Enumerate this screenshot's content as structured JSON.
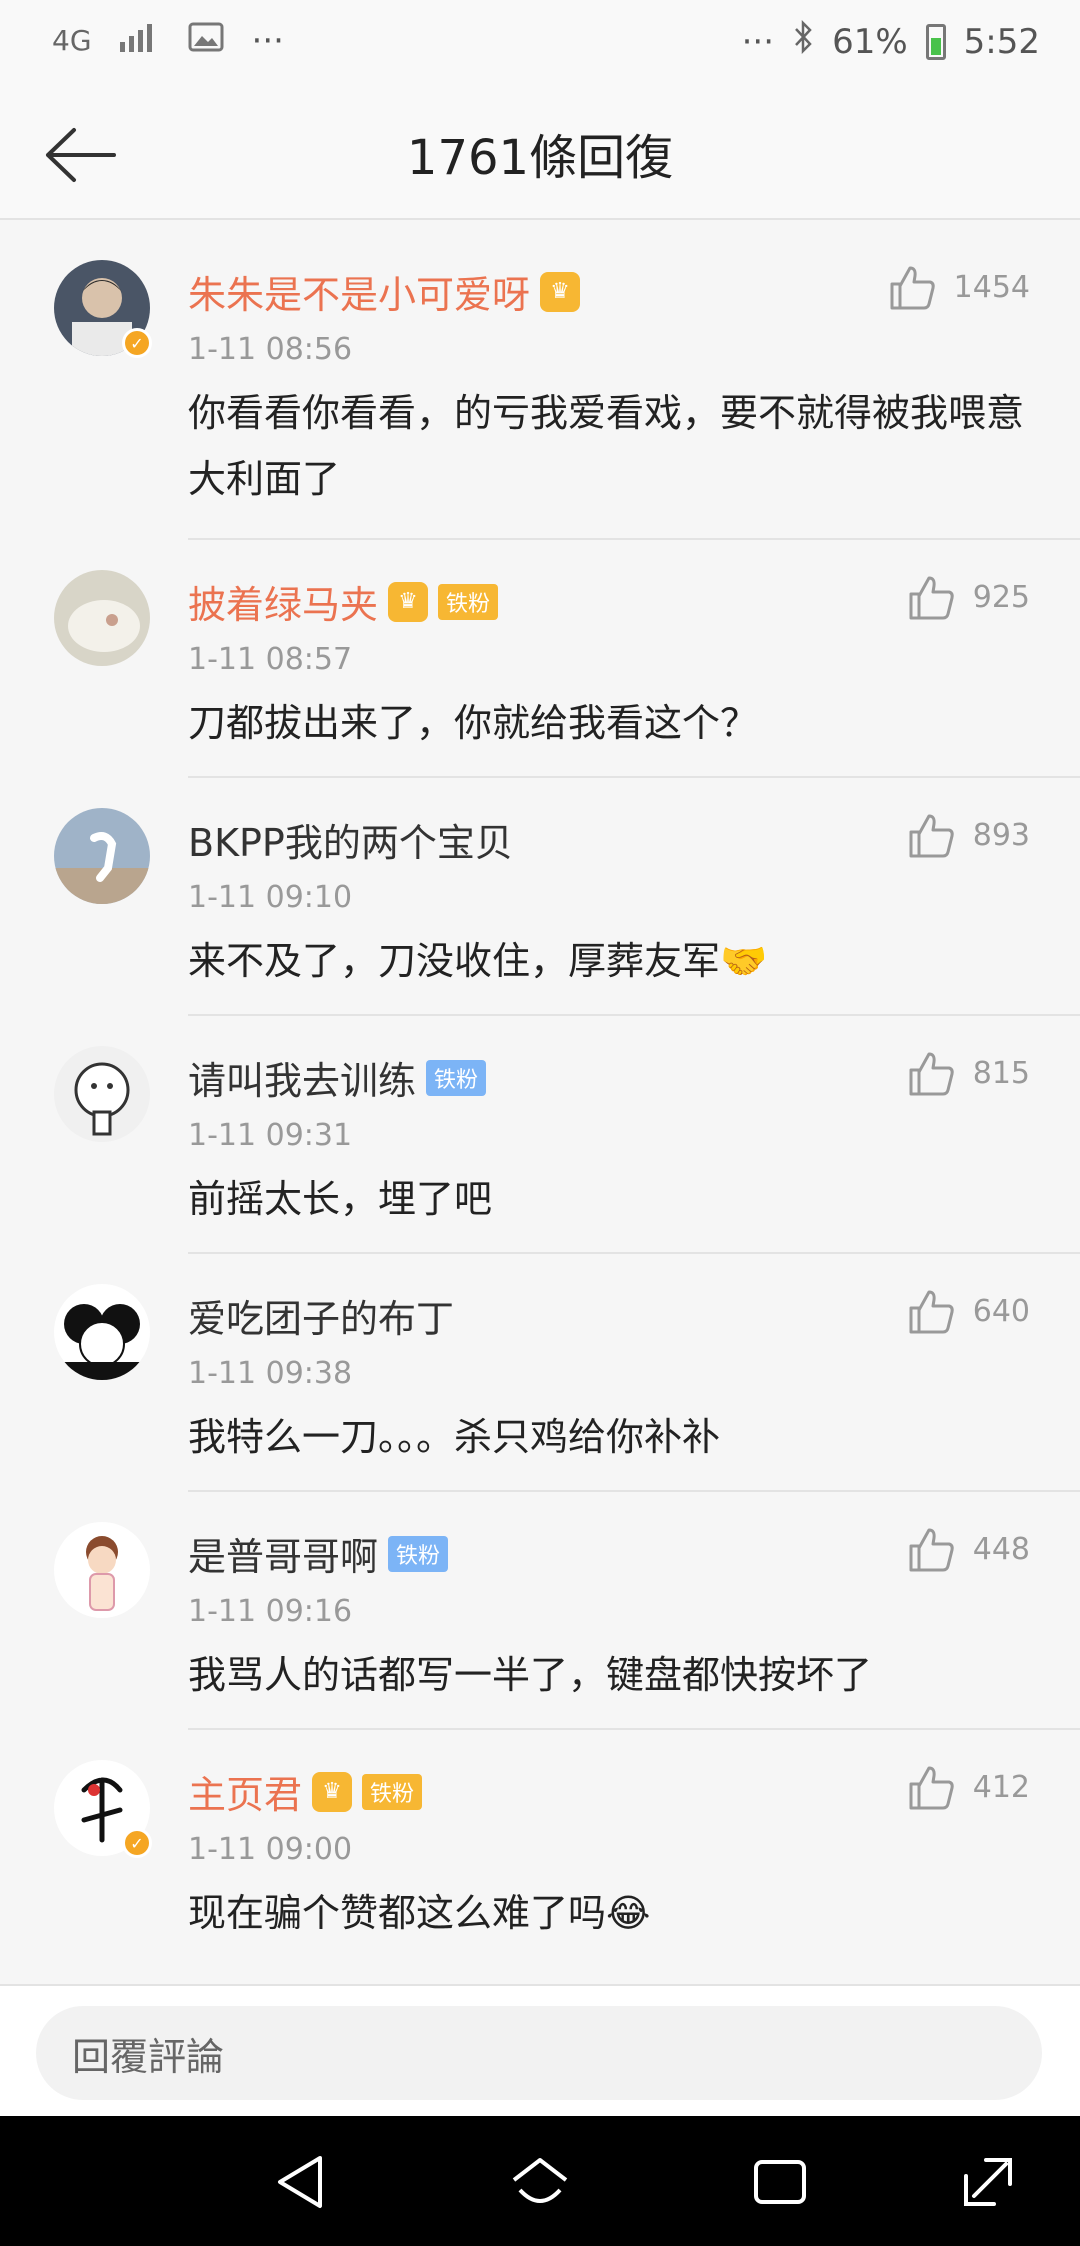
{
  "status_bar": {
    "network": "4G",
    "overflow_left": "···",
    "overflow_right": "···",
    "battery": "61%",
    "time": "5:52"
  },
  "header": {
    "title": "1761條回復",
    "back_icon": "back-arrow-icon"
  },
  "comments": [
    {
      "name": "朱朱是不是小可爱呀",
      "badge": "",
      "time": "1-11 08:56",
      "text": "你看看你看看，的亏我爱看戏，要不就得被我喂意大利面了",
      "likes": "1454",
      "vip": true,
      "verified": true
    },
    {
      "name": "披着绿马夹",
      "badge": "铁粉",
      "time": "1-11 08:57",
      "text": "刀都拔出来了，你就给我看这个？",
      "likes": "925",
      "vip": true,
      "verified": false
    },
    {
      "name": "BKPP我的两个宝贝",
      "badge": "",
      "time": "1-11 09:10",
      "text": "来不及了，刀没收住，厚葬友军🤝",
      "likes": "893",
      "vip": false,
      "verified": false
    },
    {
      "name": "请叫我去训练",
      "badge": "铁粉",
      "time": "1-11 09:31",
      "text": "前摇太长，埋了吧",
      "likes": "815",
      "vip": false,
      "verified": false
    },
    {
      "name": "爱吃团子的布丁",
      "badge": "",
      "time": "1-11 09:38",
      "text": "我特么一刀。。。杀只鸡给你补补",
      "likes": "640",
      "vip": false,
      "verified": false
    },
    {
      "name": "是普哥哥啊",
      "badge": "铁粉",
      "time": "1-11 09:16",
      "text": "我骂人的话都写一半了，键盘都快按坏了",
      "likes": "448",
      "vip": false,
      "verified": false
    },
    {
      "name": "主页君",
      "badge": "铁粉",
      "time": "1-11 09:00",
      "text": "现在骗个赞都这么难了吗😂",
      "likes": "412",
      "vip": true,
      "verified": true
    }
  ],
  "reply_bar": {
    "placeholder": "回覆評論"
  },
  "colors": {
    "vip_name": "#eb7350",
    "accent_gold": "#f7b733",
    "fan_blue": "#7cb4f6"
  }
}
